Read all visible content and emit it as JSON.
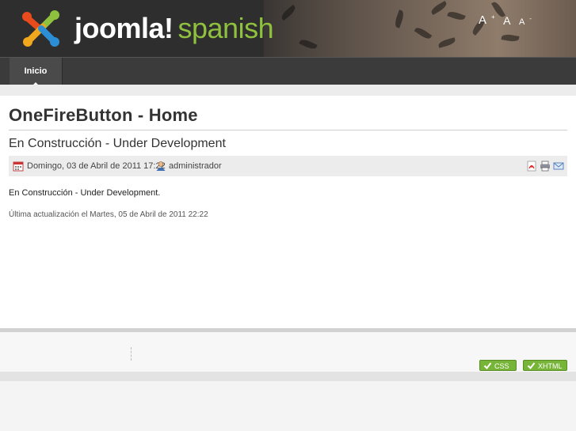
{
  "header": {
    "logo_brand": "joomla!",
    "logo_language": "spanish",
    "font_increase": "A",
    "font_reset": "A",
    "font_decrease": "A",
    "font_increase_sup": "+",
    "font_decrease_sup": "-"
  },
  "nav": {
    "items": [
      {
        "label": "Inicio"
      }
    ]
  },
  "page": {
    "title": "OneFireButton - Home"
  },
  "article": {
    "title": "En Construcción - Under Development",
    "created": "Domingo, 03 de Abril de 2011 17:22",
    "author": "administrador",
    "body": "En Construcción - Under Development.",
    "modified": "Última actualización el Martes, 05 de Abril de 2011 22:22"
  },
  "footer": {
    "badges": [
      {
        "label": "CSS"
      },
      {
        "label": "XHTML"
      }
    ]
  },
  "colors": {
    "header_bg": "#2e2e2e",
    "nav_bg": "#3b3b3b",
    "accent_green": "#8fc13e",
    "badge_green": "#77b538"
  }
}
